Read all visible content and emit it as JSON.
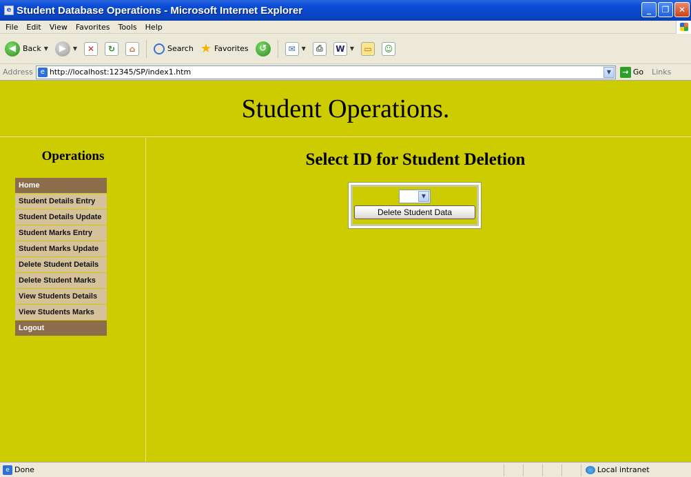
{
  "window": {
    "title": "Student Database Operations - Microsoft Internet Explorer"
  },
  "menu": [
    "File",
    "Edit",
    "View",
    "Favorites",
    "Tools",
    "Help"
  ],
  "toolbar": {
    "back_label": "Back",
    "search_label": "Search",
    "favorites_label": "Favorites"
  },
  "address": {
    "label": "Address",
    "url": "http://localhost:12345/SP/index1.htm",
    "go_label": "Go",
    "links_label": "Links"
  },
  "page": {
    "header_title": "Student Operations.",
    "sidebar_title": "Operations",
    "nav": [
      {
        "label": "Home",
        "style": "dark"
      },
      {
        "label": "Student Details Entry",
        "style": "light"
      },
      {
        "label": "Student Details Update",
        "style": "light"
      },
      {
        "label": "Student Marks Entry",
        "style": "light"
      },
      {
        "label": "Student Marks Update",
        "style": "light"
      },
      {
        "label": "Delete Student Details",
        "style": "light"
      },
      {
        "label": "Delete Student Marks",
        "style": "light"
      },
      {
        "label": "View Students Details",
        "style": "light"
      },
      {
        "label": "View Students Marks",
        "style": "light"
      },
      {
        "label": "Logout",
        "style": "dark"
      }
    ],
    "content_title": "Select ID for Student Deletion",
    "id_select_value": "",
    "delete_button": "Delete Student Data"
  },
  "status": {
    "text": "Done",
    "zone": "Local intranet"
  },
  "colors": {
    "page_bg": "#cccc00",
    "nav_dark": "#8c6d4b",
    "nav_light": "#d5c29a"
  }
}
